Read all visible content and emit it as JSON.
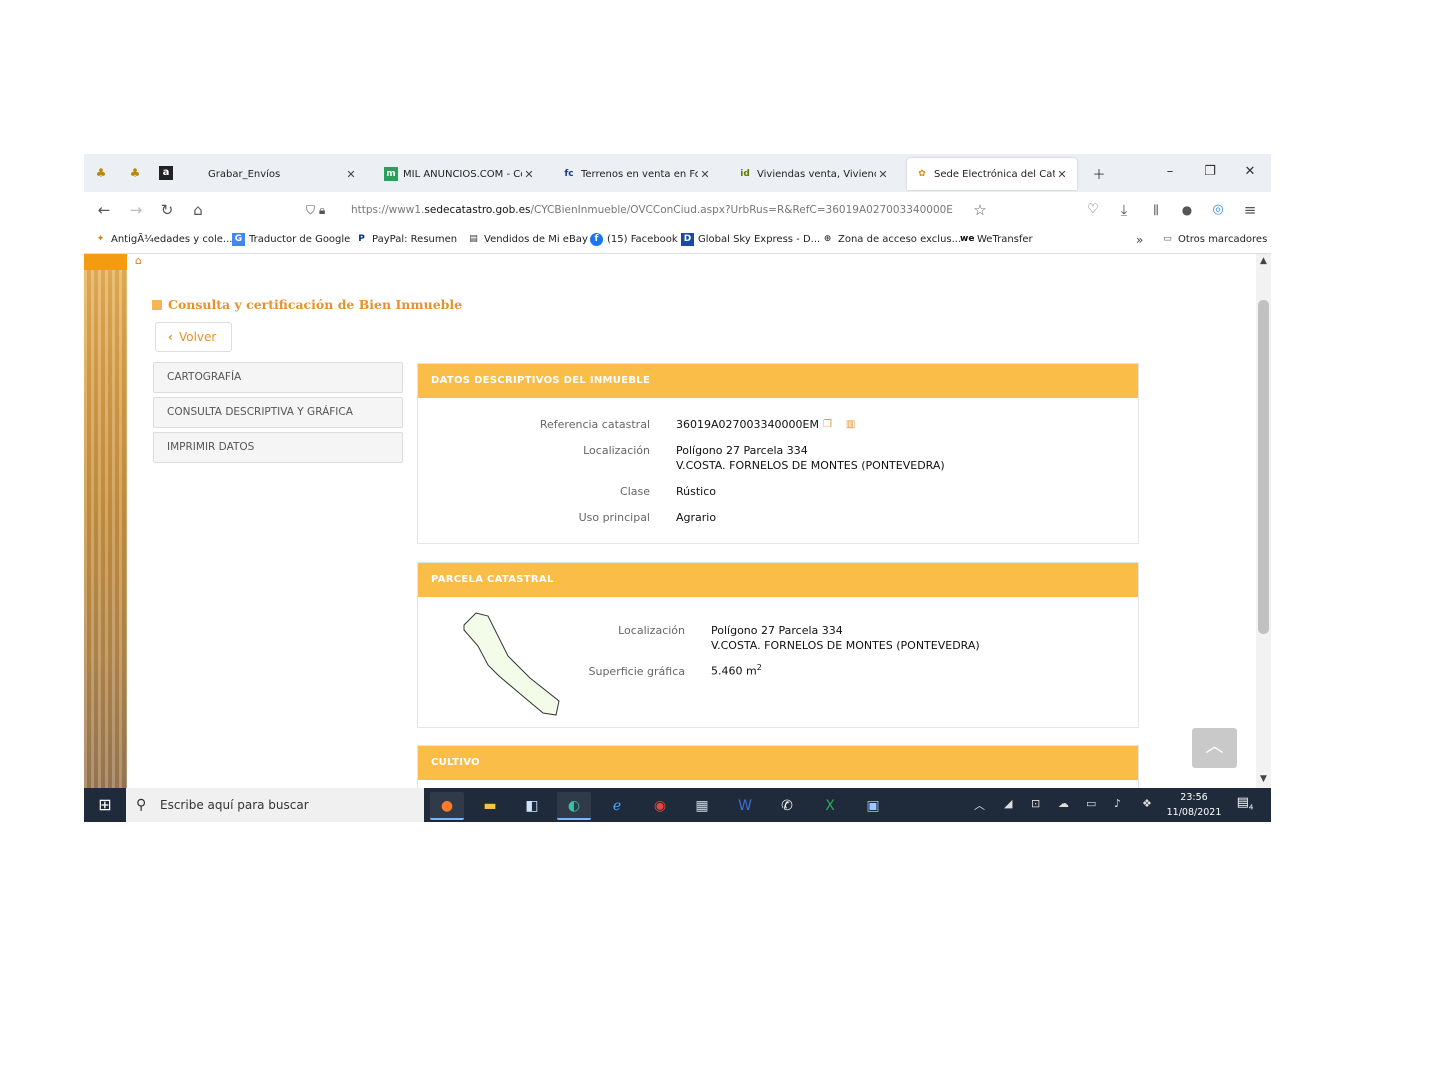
{
  "browser": {
    "tabs": [
      {
        "title": "Grabar_Envíos",
        "favicon": "amazon-icon",
        "favicon_glyph": "a"
      },
      {
        "title": "MIL ANUNCIOS.COM - Con",
        "favicon": "milanuncios-icon",
        "favicon_glyph": "m"
      },
      {
        "title": "Terrenos en venta en Forne",
        "favicon": "fotocasa-icon",
        "favicon_glyph": "fc"
      },
      {
        "title": "Viviendas venta, Viviendas a",
        "favicon": "idealista-icon",
        "favicon_glyph": "id"
      },
      {
        "title": "Sede Electrónica del Catastr",
        "favicon": "catastro-icon",
        "favicon_glyph": "✿",
        "active": true
      }
    ],
    "url_prefix": "https://www1.",
    "url_domain": "sedecatastro.gob.es",
    "url_path": "/CYCBienInmueble/OVCConCiud.aspx?UrbRus=R&RefC=36019A027003340000E",
    "bookmarks": [
      {
        "label": "AntigÃ¼edades y cole...",
        "icon": "antiques-icon"
      },
      {
        "label": "Traductor de Google",
        "icon": "translate-icon"
      },
      {
        "label": "PayPal: Resumen",
        "icon": "paypal-icon"
      },
      {
        "label": "Vendidos de Mi eBay",
        "icon": "ebay-icon"
      },
      {
        "label": "(15) Facebook",
        "icon": "facebook-icon"
      },
      {
        "label": "Global Sky Express - D...",
        "icon": "globalsky-icon"
      },
      {
        "label": "Zona de acceso exclus...",
        "icon": "globe-icon"
      },
      {
        "label": "WeTransfer",
        "icon": "wetransfer-icon"
      }
    ],
    "other_bookmarks": "Otros marcadores"
  },
  "page": {
    "title": "Consulta y certificación de Bien Inmueble",
    "back_button": "Volver",
    "menu": [
      "CARTOGRAFÍA",
      "CONSULTA DESCRIPTIVA Y GRÁFICA",
      "IMPRIMIR DATOS"
    ],
    "datos": {
      "header": "DATOS DESCRIPTIVOS DEL INMUEBLE",
      "ref_label": "Referencia catastral",
      "ref_value": "36019A027003340000EM",
      "loc_label": "Localización",
      "loc_line1": "Polígono 27 Parcela 334",
      "loc_line2": "V.COSTA. FORNELOS DE MONTES (PONTEVEDRA)",
      "clase_label": "Clase",
      "clase_value": "Rústico",
      "uso_label": "Uso principal",
      "uso_value": "Agrario"
    },
    "parcela": {
      "header": "PARCELA CATASTRAL",
      "loc_label": "Localización",
      "loc_line1": "Polígono 27 Parcela 334",
      "loc_line2": "V.COSTA. FORNELOS DE MONTES (PONTEVEDRA)",
      "sup_label": "Superficie gráfica",
      "sup_value": "5.460 m",
      "sup_unit_exp": "2"
    },
    "cultivo": {
      "header": "CULTIVO"
    }
  },
  "taskbar": {
    "search_placeholder": "Escribe aquí para buscar",
    "time": "23:56",
    "date": "11/08/2021",
    "notifications": "4"
  }
}
